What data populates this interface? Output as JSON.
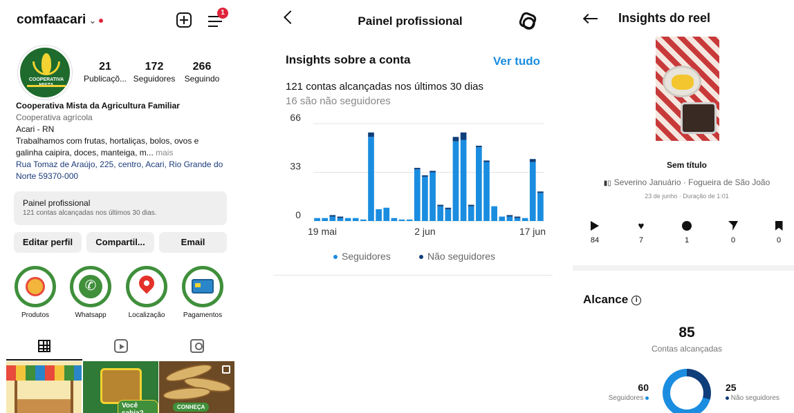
{
  "profile": {
    "username": "comfaacari",
    "notification_count": "1",
    "avatar_text": "COOPERATIVA MISTA",
    "stats": [
      {
        "value": "21",
        "label": "Publicaçõ..."
      },
      {
        "value": "172",
        "label": "Seguidores"
      },
      {
        "value": "266",
        "label": "Seguindo"
      }
    ],
    "bio": {
      "name": "Cooperativa Mista da Agricultura Familiar",
      "category": "Cooperativa agrícola",
      "city": "Acari - RN",
      "description": "Trabalhamos com frutas, hortaliças, bolos, ovos e galinha caipira, doces, manteiga, m...",
      "more": " mais",
      "address": "Rua Tomaz de Araújo, 225, centro, Acari, Rio Grande do Norte 59370-000"
    },
    "pro_panel": {
      "title": "Painel profissional",
      "subtitle": "121 contas alcançadas nos últimos 30 dias."
    },
    "buttons": {
      "edit": "Editar perfil",
      "share": "Compartil...",
      "email": "Email"
    },
    "highlights": [
      "Produtos",
      "Whatsapp",
      "Localização",
      "Pagamentos"
    ],
    "thumbs": {
      "sabia": "Você sabia?",
      "conheca": "CONHEÇA"
    }
  },
  "dashboard": {
    "title": "Painel profissional",
    "insights_title": "Insights sobre a conta",
    "see_all": "Ver tudo",
    "reach_text": "121 contas alcançadas nos últimos 30 dias",
    "non_followers_text": "16 são não seguidores",
    "legend": [
      "Seguidores",
      "Não seguidores"
    ]
  },
  "reel": {
    "title": "Insights do reel",
    "caption": "Sem título",
    "audio": "Severino Januário · Fogueira de São João",
    "date": "23 de junho · Duração de 1:01",
    "metrics": [
      {
        "icon": "play-icon",
        "value": "84"
      },
      {
        "icon": "heart-icon",
        "value": "7"
      },
      {
        "icon": "comment-icon",
        "value": "1"
      },
      {
        "icon": "send-icon",
        "value": "0"
      },
      {
        "icon": "bookmark-icon",
        "value": "0"
      }
    ],
    "reach_title": "Alcance",
    "reach_value": "85",
    "reach_label": "Contas alcançadas",
    "followers": {
      "value": "60",
      "label": "Seguidores"
    },
    "non_followers": {
      "value": "25",
      "label": "Não seguidores"
    }
  },
  "colors": {
    "followers": "#1a8de0",
    "non_followers": "#0f3e7a",
    "accent": "#1a8de0",
    "notification": "#e0243b"
  },
  "chart_data": {
    "type": "bar",
    "x": [
      "19 mai",
      "20 mai",
      "21 mai",
      "22 mai",
      "23 mai",
      "24 mai",
      "25 mai",
      "26 mai",
      "27 mai",
      "28 mai",
      "29 mai",
      "30 mai",
      "31 mai",
      "1 jun",
      "2 jun",
      "3 jun",
      "4 jun",
      "5 jun",
      "6 jun",
      "7 jun",
      "8 jun",
      "9 jun",
      "10 jun",
      "11 jun",
      "12 jun",
      "13 jun",
      "14 jun",
      "15 jun",
      "16 jun",
      "17 jun"
    ],
    "xticks": [
      "19 mai",
      "2 jun",
      "17 jun"
    ],
    "yticks": [
      "66",
      "33",
      "0"
    ],
    "ylim": [
      0,
      66
    ],
    "series": [
      {
        "name": "Seguidores",
        "values": [
          2,
          2,
          3,
          2,
          2,
          2,
          1,
          57,
          8,
          9,
          2,
          1,
          1,
          35,
          30,
          33,
          10,
          8,
          54,
          55,
          10,
          50,
          40,
          10,
          3,
          3,
          2,
          2,
          40,
          19
        ]
      },
      {
        "name": "Não seguidores",
        "values": [
          0,
          0,
          1,
          1,
          0,
          0,
          0,
          3,
          0,
          0,
          0,
          0,
          0,
          1,
          1,
          1,
          1,
          1,
          3,
          5,
          1,
          1,
          1,
          0,
          0,
          1,
          1,
          0,
          2,
          1
        ]
      }
    ],
    "legend": "bottom"
  }
}
